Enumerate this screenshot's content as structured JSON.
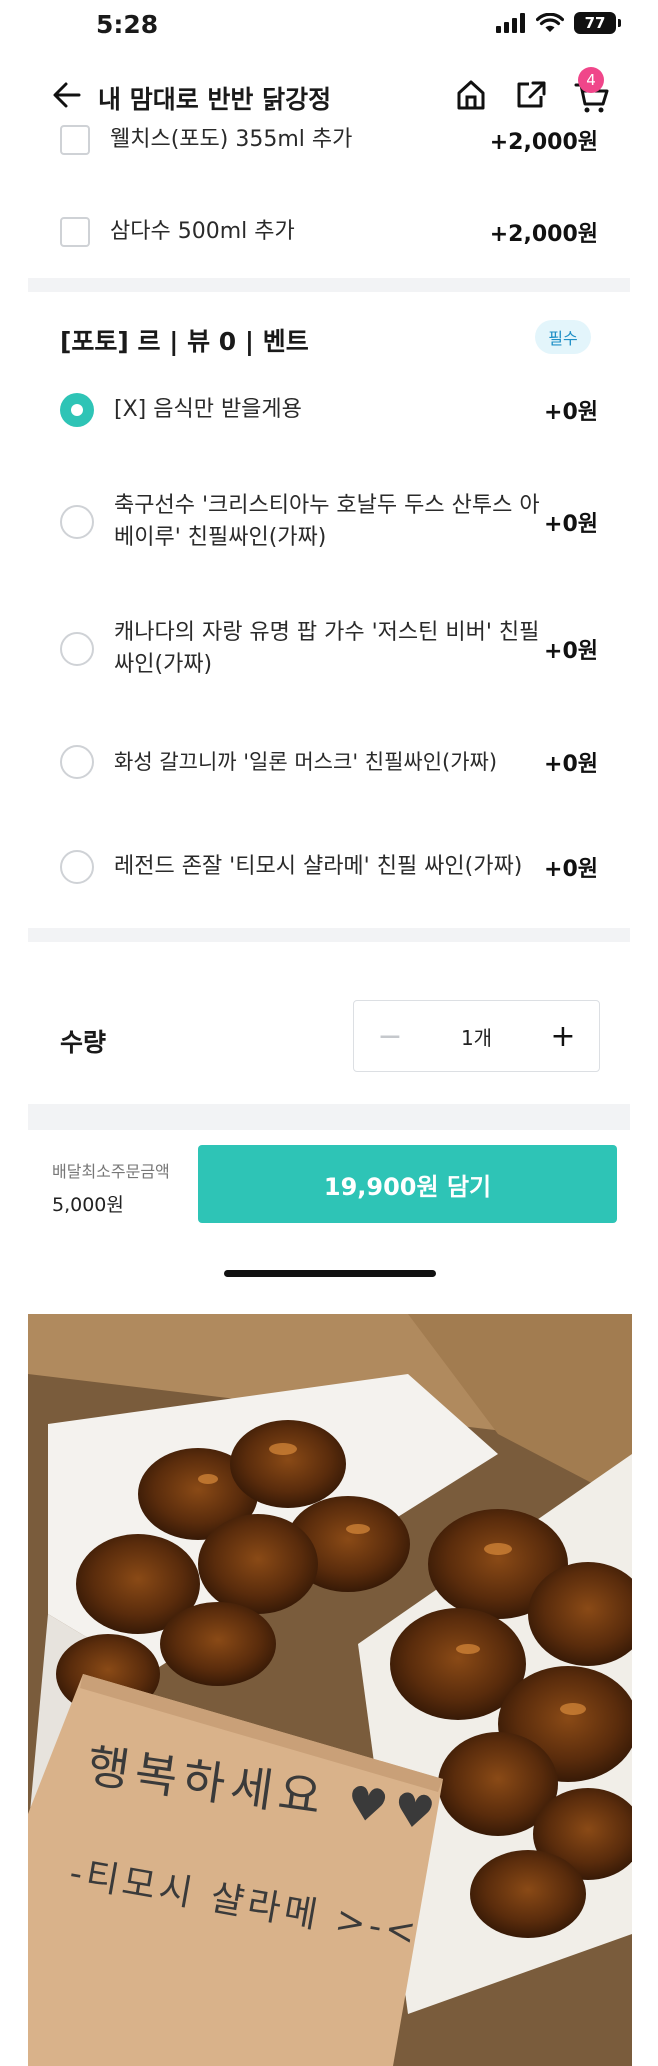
{
  "status_bar": {
    "time": "5:28",
    "battery": "77"
  },
  "header": {
    "title": "내 맘대로 반반 닭강정",
    "cart_count": "4"
  },
  "drink_options": [
    {
      "label": "웰치스(포도) 355ml 추가",
      "price": "+2,000원"
    },
    {
      "label": "삼다수 500ml 추가",
      "price": "+2,000원"
    }
  ],
  "event_section": {
    "title": "[포토] 르 | 뷰 0 |  벤트",
    "badge": "필수",
    "options": [
      {
        "label": "[X] 음식만 받을게용",
        "price": "+0원",
        "selected": true
      },
      {
        "label": "축구선수 '크리스티아누 호날두 두스 산투스 아베이루' 친필싸인(가짜)",
        "price": "+0원",
        "selected": false
      },
      {
        "label": "캐나다의 자랑 유명 팝 가수 '저스틴 비버' 친필싸인(가짜)",
        "price": "+0원",
        "selected": false
      },
      {
        "label": "화성 갈끄니까 '일론 머스크' 친필싸인(가짜)",
        "price": "+0원",
        "selected": false
      },
      {
        "label": "레전드 존잘 '티모시 샬라메' 친필 싸인(가짜)",
        "price": "+0원",
        "selected": false
      }
    ]
  },
  "quantity": {
    "label": "수량",
    "value": "1개",
    "minus": "−",
    "plus": "+"
  },
  "bottom_bar": {
    "min_order_label": "배달최소주문금액",
    "min_order_value": "5,000원",
    "add_button": "19,900원 담기"
  },
  "photo": {
    "note_line1": "행복하세요 ♥♥",
    "note_line2": "-티모시 샬라메 >-<"
  },
  "colors": {
    "accent": "#2ec4b6",
    "badge_pink": "#f0468a",
    "required_bg": "#e3f5fb",
    "required_text": "#1e8fc6"
  }
}
